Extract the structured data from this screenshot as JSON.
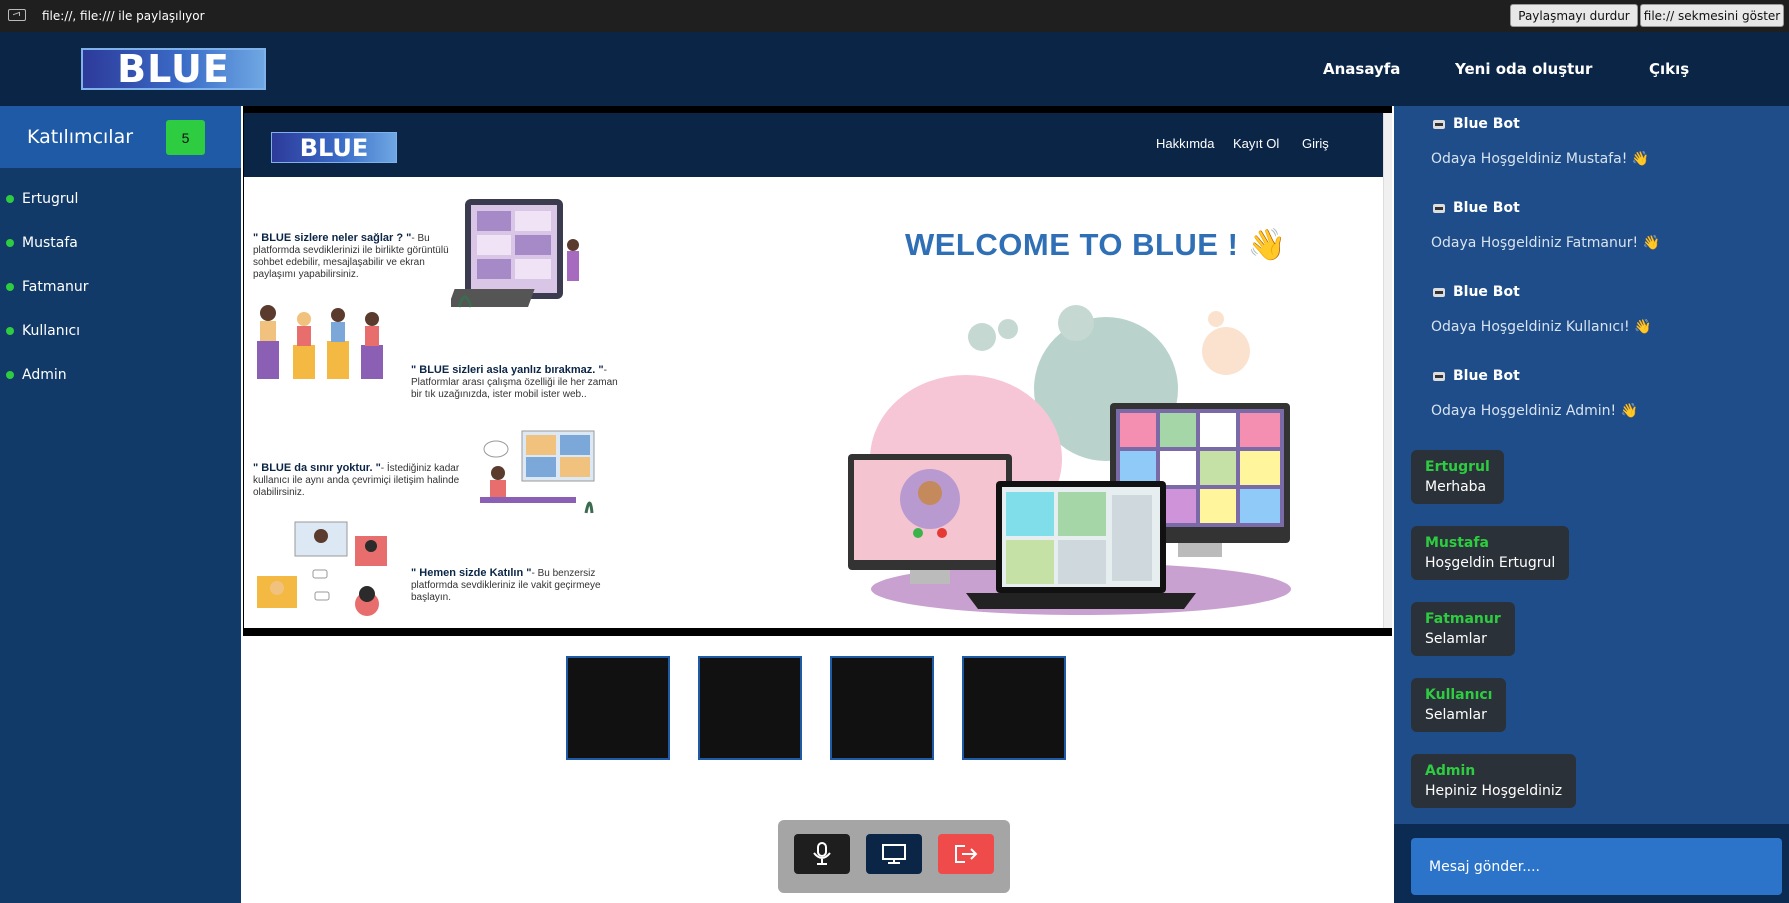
{
  "share_bar": {
    "text": "file://, file:/// ile paylaşılıyor",
    "stop_label": "Paylaşmayı durdur",
    "show_tab_label": "file:// sekmesini göster"
  },
  "header": {
    "logo": "BLUE",
    "nav": [
      "Anasayfa",
      "Yeni oda oluştur",
      "Çıkış"
    ]
  },
  "participants": {
    "title": "Katılımcılar",
    "count": "5",
    "names": [
      "Ertugrul",
      "Mustafa",
      "Fatmanur",
      "Kullanıcı",
      "Admin"
    ]
  },
  "shared_page": {
    "logo": "BLUE",
    "nav": [
      "Hakkımda",
      "Kayıt Ol",
      "Giriş"
    ],
    "welcome": "WELCOME TO BLUE !",
    "welcome_emoji": "👋",
    "features": [
      {
        "title": "\" BLUE sizlere neler sağlar ? \"",
        "body": "- Bu platformda sevdiklerinizi ile birlikte görüntülü sohbet edebilir, mesajlaşabilir ve ekran paylaşımı yapabilirsiniz."
      },
      {
        "title": "\" BLUE sizleri asla yanlız bırakmaz. \"",
        "body": "- Platformlar arası çalışma özelliği ile her zaman bir tık uzağınızda, ister mobil ister web.."
      },
      {
        "title": "\" BLUE da sınır yoktur. \"",
        "body": "- İstediğiniz kadar kullanıcı ile aynı anda çevrimiçi iletişim halinde olabilirsiniz."
      },
      {
        "title": "\" Hemen sizde Katılın \"",
        "body": "- Bu benzersiz platformda sevdikleriniz ile vakit geçirmeye başlayın."
      }
    ]
  },
  "controls": {
    "icons": [
      "microphone-icon",
      "screen-share-icon",
      "leave-icon"
    ],
    "colors": {
      "mic": "#1e1e1e",
      "screen": "#0b2547",
      "leave": "#ef4b4b"
    }
  },
  "chat": {
    "bot_messages": [
      {
        "name": "Blue Bot",
        "text": "Odaya Hoşgeldiniz Mustafa! 👋"
      },
      {
        "name": "Blue Bot",
        "text": "Odaya Hoşgeldiniz Fatmanur! 👋"
      },
      {
        "name": "Blue Bot",
        "text": "Odaya Hoşgeldiniz Kullanıcı! 👋"
      },
      {
        "name": "Blue Bot",
        "text": "Odaya Hoşgeldiniz Admin! 👋"
      }
    ],
    "messages": [
      {
        "user": "Ertugrul",
        "text": "Merhaba"
      },
      {
        "user": "Mustafa",
        "text": "Hoşgeldin Ertugrul"
      },
      {
        "user": "Fatmanur",
        "text": "Selamlar"
      },
      {
        "user": "Kullanıcı",
        "text": "Selamlar"
      },
      {
        "user": "Admin",
        "text": "Hepiniz Hoşgeldiniz"
      }
    ],
    "input_placeholder": "Mesaj gönder...."
  },
  "colors": {
    "header_bg": "#0b2547",
    "sidebar_bg": "#123a68",
    "accent_green": "#2ecc40",
    "chat_bg": "#1e4d8a"
  }
}
